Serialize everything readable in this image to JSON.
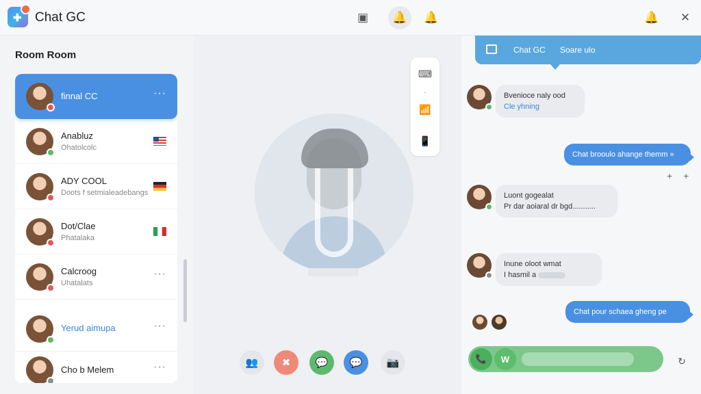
{
  "app": {
    "title": "Chat GC",
    "logo_letter": "✚"
  },
  "topbar": {
    "icons": [
      "chat-icon",
      "bell-icon",
      "bell-outline-icon"
    ],
    "right_icons": [
      "notification-icon",
      "close-icon"
    ],
    "glyphs": {
      "chat": "▣",
      "bell": "🔔",
      "bell2": "🔔",
      "notify": "🔔",
      "close": "✕"
    }
  },
  "sidebar": {
    "heading": "Room Room",
    "rooms": [
      {
        "name": "finnal CC",
        "sub": "",
        "selected": true,
        "dots": "···"
      },
      {
        "name": "Anabluz",
        "sub": "Ohatolcolc",
        "flag": "us"
      },
      {
        "name": "ADY COOL",
        "sub": "Doots f setmialeadebangs",
        "flag": "de"
      },
      {
        "name": "Dot/Clae",
        "sub": "Phatalaka",
        "flag": "it"
      },
      {
        "name": "Calcroog",
        "sub": "Uhatalats",
        "dots": "···"
      },
      {
        "name": "Yerud aimupa",
        "sub": "",
        "dots": "···"
      },
      {
        "name": "Cho b Melem",
        "sub": "",
        "dots": "···"
      }
    ]
  },
  "colors": {
    "accent": "#4a90e2",
    "green": "#5cb96d",
    "red": "#e06a5a"
  },
  "side_tools": [
    "keyboard-icon",
    "equalizer-icon",
    "device-icon"
  ],
  "side_glyphs": {
    "keyboard": "⌨",
    "sep": "·",
    "equalizer": "📶",
    "device": "📱"
  },
  "call_controls": {
    "glyphs": {
      "add": "👥",
      "end": "✖",
      "chat": "💬",
      "msg": "💬",
      "camera": "📷"
    }
  },
  "chat": {
    "header_title": "Chat GC",
    "header_sub": "Soare ulo",
    "messages": [
      {
        "dir": "in",
        "line1": "Bvenioce naly ood",
        "line2": "Cle yhning"
      },
      {
        "dir": "out",
        "text": "Chat brooulo ahange themm »"
      },
      {
        "dir": "in",
        "line1": "Luont gogealat",
        "line2": "Pr dar aoiaral dr bgd..........."
      },
      {
        "dir": "in",
        "line1": "Inune oloot wmat",
        "line2": "I hasmil a"
      },
      {
        "dir": "out",
        "text": "Chat pour schaea gheng pe"
      }
    ],
    "plus": "+ +",
    "react_glyph": "↻"
  },
  "input": {
    "phone_glyph": "📞",
    "whatsapp_glyph": "W"
  }
}
